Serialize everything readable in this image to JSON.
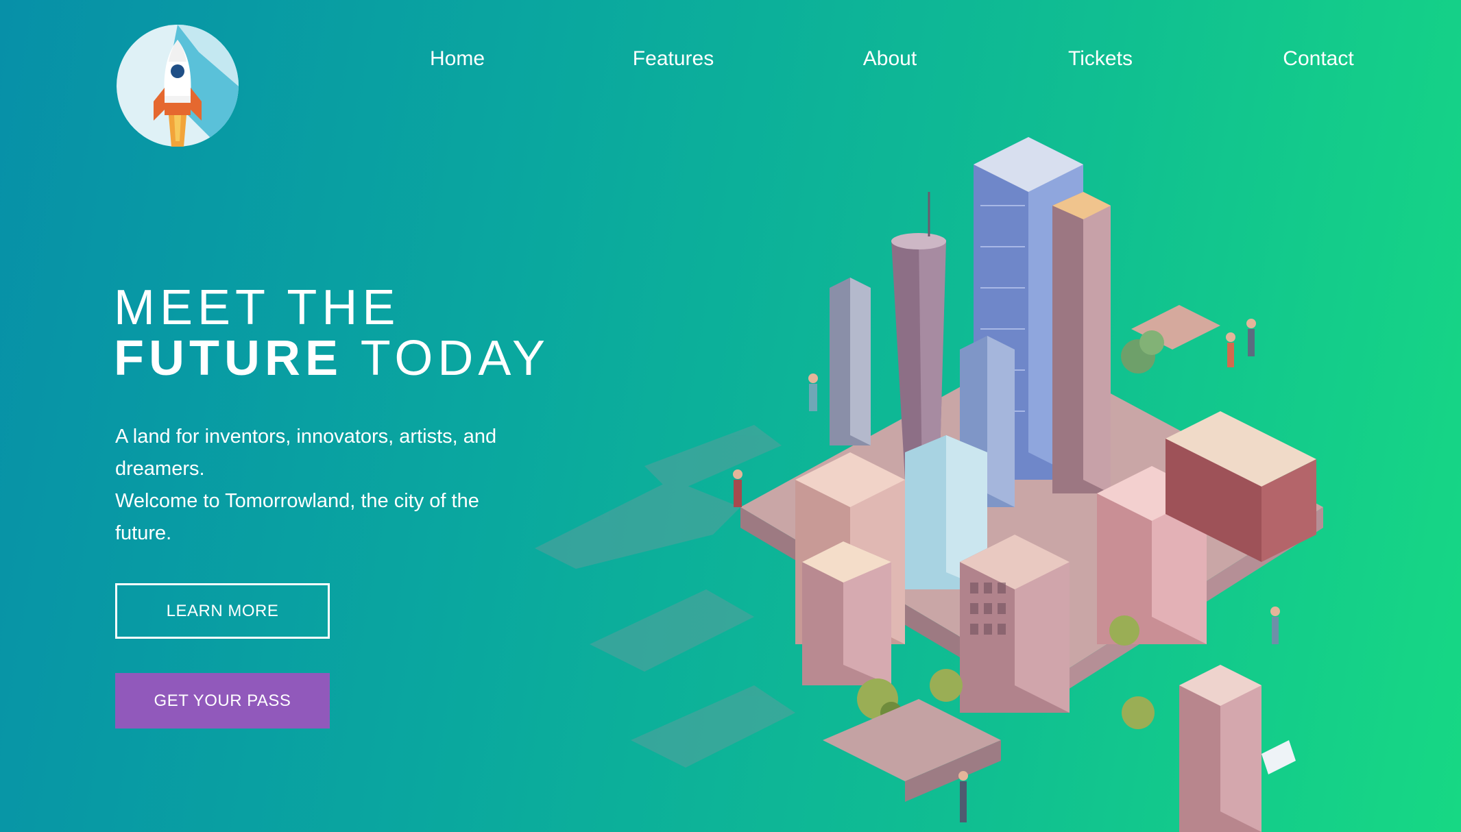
{
  "nav": {
    "items": [
      {
        "label": "Home"
      },
      {
        "label": "Features"
      },
      {
        "label": "About"
      },
      {
        "label": "Tickets"
      },
      {
        "label": "Contact"
      }
    ]
  },
  "logo": {
    "icon": "rocket-icon"
  },
  "hero": {
    "title_line1": "MEET THE",
    "title_line2_bold": "FUTURE",
    "title_line2_light": " TODAY",
    "description_line1": "A land for inventors, innovators, artists, and dreamers.",
    "description_line2": "Welcome to Tomorrowland, the city of the future."
  },
  "buttons": {
    "learn_more": "LEARN MORE",
    "get_pass": "GET YOUR PASS"
  },
  "colors": {
    "gradient_start": "#0790a8",
    "gradient_end": "#17d884",
    "primary_button": "#9159bb",
    "text": "#ffffff"
  }
}
